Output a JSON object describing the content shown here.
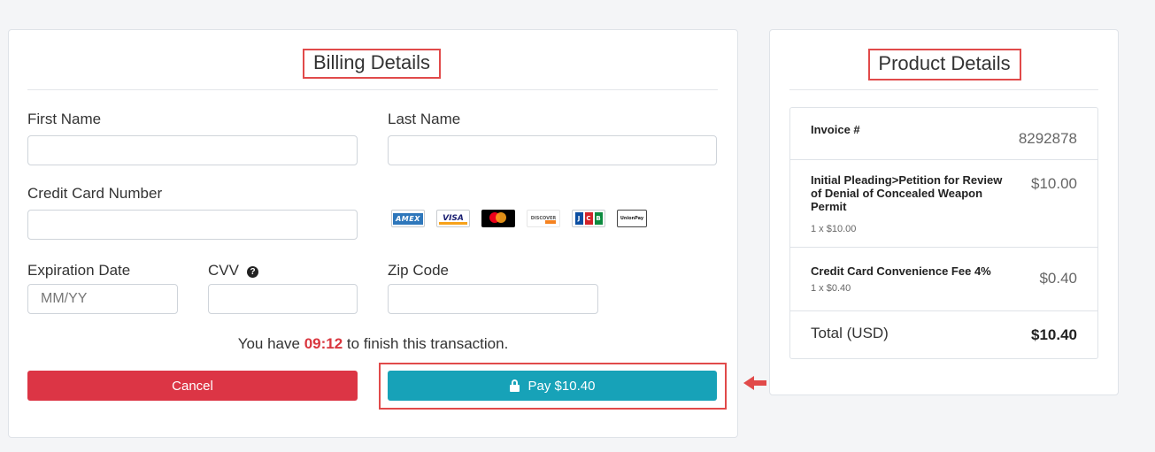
{
  "billing": {
    "title": "Billing Details",
    "first_name_label": "First Name",
    "last_name_label": "Last Name",
    "card_number_label": "Credit Card Number",
    "expiration_label": "Expiration Date",
    "expiration_placeholder": "MM/YY",
    "cvv_label": "CVV",
    "zip_label": "Zip Code",
    "card_brands": [
      "AMEX",
      "VISA",
      "Mastercard",
      "DISCOVER",
      "JCB",
      "UnionPay"
    ],
    "timer_prefix": "You have",
    "timer_value": "09:12",
    "timer_suffix": "to finish this transaction.",
    "cancel_label": "Cancel",
    "pay_label": "Pay $10.40"
  },
  "product": {
    "title": "Product Details",
    "invoice_label": "Invoice #",
    "invoice_number": "8292878",
    "items": [
      {
        "name": "Initial Pleading>Petition for Review of Denial of Concealed Weapon Permit",
        "qty": "1 x $10.00",
        "price": "$10.00"
      },
      {
        "name": "Credit Card Convenience Fee 4%",
        "qty": "1 x $0.40",
        "price": "$0.40"
      }
    ],
    "total_label": "Total (USD)",
    "total_value": "$10.40"
  },
  "colors": {
    "highlight": "#e14a4a",
    "cancel": "#dc3545",
    "pay": "#17a2b8",
    "timer": "#d9363e"
  }
}
